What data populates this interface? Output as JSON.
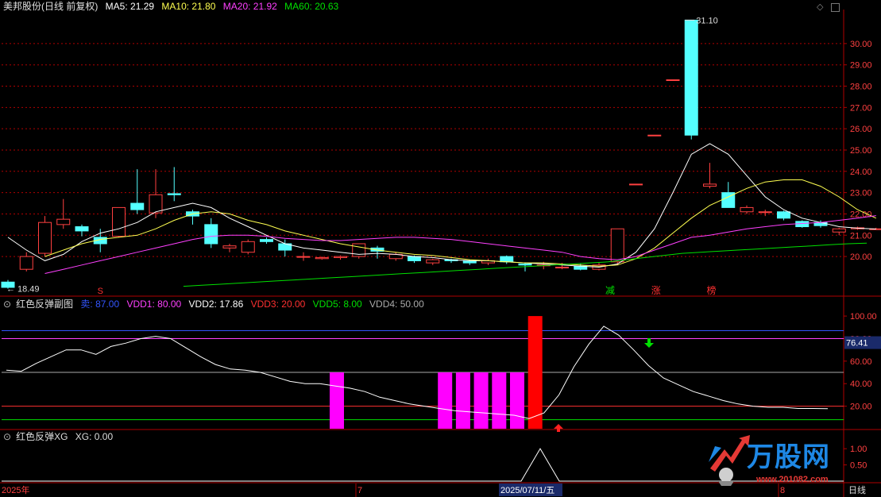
{
  "main_header": {
    "title": "美邦股份(日线 前复权)",
    "ma5": "MA5: 21.29",
    "ma10": "MA10: 21.80",
    "ma20": "MA20: 21.92",
    "ma60": "MA60: 20.63"
  },
  "sub_header": {
    "title": "红色反弹副图",
    "sell": "卖: 87.00",
    "vdd1": "VDD1: 80.00",
    "vdd2": "VDD2: 17.86",
    "vdd3": "VDD3: 20.00",
    "vdd5": "VDD5: 8.00",
    "vdd4": "VDD4: 50.00"
  },
  "sub2_header": {
    "title": "红色反弹XG",
    "xg": "XG: 0.00"
  },
  "labels": {
    "high": "31.10",
    "low": "18.49",
    "cur_value": "76.41",
    "mark_s": "S",
    "mark_jian": "减",
    "mark_zhang": "涨",
    "mark_bang": "榜"
  },
  "date_axis": {
    "start": "2025年",
    "m7": "7",
    "selected": "2025/07/11/五",
    "m8": "8",
    "period": "日线"
  },
  "watermark": {
    "text": "万股网",
    "url": "www.201082.com"
  },
  "colors": {
    "up": "#ff4040",
    "down": "#54ffff",
    "ma5": "#ffffff",
    "ma10": "#ffff50",
    "ma20": "#ff40ff",
    "ma60": "#00e000",
    "grid": "#b00000"
  },
  "chart_data": [
    {
      "type": "candlestick",
      "title": "美邦股份(日线 前复权)",
      "ylim": [
        18.4,
        31.3
      ],
      "y_ticks": [
        20.0,
        21.0,
        22.0,
        23.0,
        24.0,
        25.0,
        26.0,
        27.0,
        28.0,
        29.0,
        30.0
      ],
      "candles": [
        {
          "o": 18.8,
          "c": 18.55,
          "h": 18.9,
          "l": 18.49
        },
        {
          "o": 19.4,
          "c": 20.0,
          "h": 20.2,
          "l": 19.3
        },
        {
          "o": 20.15,
          "c": 21.6,
          "h": 21.9,
          "l": 20.0
        },
        {
          "o": 21.5,
          "c": 21.75,
          "h": 22.7,
          "l": 21.3
        },
        {
          "o": 21.4,
          "c": 21.2,
          "h": 21.5,
          "l": 20.95
        },
        {
          "o": 20.9,
          "c": 20.6,
          "h": 21.3,
          "l": 20.2
        },
        {
          "o": 20.95,
          "c": 22.3,
          "h": 22.3,
          "l": 20.9
        },
        {
          "o": 22.5,
          "c": 22.2,
          "h": 24.1,
          "l": 22.0
        },
        {
          "o": 22.05,
          "c": 22.9,
          "h": 24.1,
          "l": 21.8
        },
        {
          "o": 22.95,
          "c": 22.9,
          "h": 24.2,
          "l": 22.6
        },
        {
          "o": 22.1,
          "c": 21.9,
          "h": 22.2,
          "l": 21.5
        },
        {
          "o": 21.5,
          "c": 20.6,
          "h": 21.8,
          "l": 20.4
        },
        {
          "o": 20.4,
          "c": 20.5,
          "h": 20.6,
          "l": 20.2
        },
        {
          "o": 20.2,
          "c": 20.7,
          "h": 20.8,
          "l": 20.1
        },
        {
          "o": 20.8,
          "c": 20.7,
          "h": 20.9,
          "l": 20.6
        },
        {
          "o": 20.6,
          "c": 20.3,
          "h": 20.8,
          "l": 20.0
        },
        {
          "o": 20.0,
          "c": 20.0,
          "h": 20.2,
          "l": 19.8
        },
        {
          "o": 19.9,
          "c": 19.95,
          "h": 20.0,
          "l": 19.85
        },
        {
          "o": 19.95,
          "c": 20.0,
          "h": 20.05,
          "l": 19.85
        },
        {
          "o": 20.0,
          "c": 20.6,
          "h": 20.6,
          "l": 19.9
        },
        {
          "o": 20.4,
          "c": 20.25,
          "h": 20.5,
          "l": 19.9
        },
        {
          "o": 19.9,
          "c": 20.1,
          "h": 20.2,
          "l": 19.8
        },
        {
          "o": 20.0,
          "c": 19.8,
          "h": 20.05,
          "l": 19.7
        },
        {
          "o": 19.7,
          "c": 19.85,
          "h": 19.9,
          "l": 19.6
        },
        {
          "o": 19.85,
          "c": 19.8,
          "h": 19.9,
          "l": 19.7
        },
        {
          "o": 19.8,
          "c": 19.7,
          "h": 19.85,
          "l": 19.6
        },
        {
          "o": 19.7,
          "c": 19.8,
          "h": 19.9,
          "l": 19.6
        },
        {
          "o": 20.0,
          "c": 19.75,
          "h": 20.05,
          "l": 19.65
        },
        {
          "o": 19.65,
          "c": 19.6,
          "h": 19.7,
          "l": 19.3
        },
        {
          "o": 19.6,
          "c": 19.6,
          "h": 19.75,
          "l": 19.4
        },
        {
          "o": 19.5,
          "c": 19.5,
          "h": 19.7,
          "l": 19.4
        },
        {
          "o": 19.55,
          "c": 19.4,
          "h": 19.65,
          "l": 19.35
        },
        {
          "o": 19.4,
          "c": 19.6,
          "h": 19.7,
          "l": 19.35
        },
        {
          "o": 19.75,
          "c": 21.3,
          "h": 21.3,
          "l": 19.6
        },
        {
          "o": 23.4,
          "c": 23.4,
          "h": 23.4,
          "l": 23.4
        },
        {
          "o": 25.7,
          "c": 25.7,
          "h": 25.7,
          "l": 25.7
        },
        {
          "o": 28.3,
          "c": 28.3,
          "h": 28.3,
          "l": 28.3
        },
        {
          "o": 31.1,
          "c": 25.7,
          "h": 31.1,
          "l": 25.5
        },
        {
          "o": 23.3,
          "c": 23.4,
          "h": 24.4,
          "l": 23.2
        },
        {
          "o": 23.0,
          "c": 22.3,
          "h": 23.5,
          "l": 22.3
        },
        {
          "o": 22.1,
          "c": 22.3,
          "h": 22.4,
          "l": 22.0
        },
        {
          "o": 22.1,
          "c": 22.1,
          "h": 22.2,
          "l": 21.9
        },
        {
          "o": 22.1,
          "c": 21.8,
          "h": 22.15,
          "l": 21.7
        },
        {
          "o": 21.65,
          "c": 21.4,
          "h": 21.7,
          "l": 21.35
        },
        {
          "o": 21.6,
          "c": 21.45,
          "h": 21.7,
          "l": 21.35
        },
        {
          "o": 21.15,
          "c": 21.3,
          "h": 21.35,
          "l": 21.0
        },
        {
          "o": 21.3,
          "c": 21.35,
          "h": 21.4,
          "l": 21.25
        },
        {
          "o": 21.3,
          "c": 21.3,
          "h": 21.35,
          "l": 21.25
        }
      ],
      "series": [
        {
          "name": "MA5",
          "values": [
            20.9,
            20.3,
            19.8,
            20.1,
            20.7,
            21.1,
            21.3,
            21.6,
            22.1,
            22.3,
            22.5,
            22.3,
            21.8,
            21.4,
            21.0,
            20.6,
            20.4,
            20.3,
            20.2,
            20.1,
            20.15,
            20.1,
            20.0,
            19.95,
            19.85,
            19.8,
            19.8,
            19.75,
            19.7,
            19.65,
            19.6,
            19.55,
            19.5,
            19.65,
            20.2,
            21.3,
            23.0,
            24.8,
            25.3,
            24.8,
            23.8,
            22.8,
            22.2,
            21.8,
            21.6,
            21.4,
            21.33,
            21.29
          ]
        },
        {
          "name": "MA10",
          "values": [
            null,
            null,
            20.0,
            20.3,
            20.6,
            20.8,
            20.9,
            21.0,
            21.3,
            21.7,
            22.0,
            22.1,
            22.0,
            21.7,
            21.5,
            21.2,
            21.0,
            20.8,
            20.6,
            20.45,
            20.3,
            20.2,
            20.1,
            20.05,
            19.95,
            19.85,
            19.8,
            19.75,
            19.7,
            19.7,
            19.65,
            19.6,
            19.55,
            19.6,
            19.9,
            20.4,
            21.1,
            21.8,
            22.4,
            22.8,
            23.2,
            23.5,
            23.6,
            23.6,
            23.3,
            22.8,
            22.2,
            21.8
          ]
        },
        {
          "name": "MA20",
          "values": [
            null,
            null,
            19.2,
            19.4,
            19.6,
            19.8,
            20.0,
            20.2,
            20.4,
            20.6,
            20.8,
            20.95,
            21.0,
            21.0,
            20.95,
            20.85,
            20.8,
            20.75,
            20.75,
            20.8,
            20.85,
            20.9,
            20.9,
            20.85,
            20.8,
            20.7,
            20.6,
            20.5,
            20.4,
            20.3,
            20.2,
            20.0,
            19.9,
            19.85,
            20.0,
            20.3,
            20.6,
            20.9,
            21.0,
            21.15,
            21.3,
            21.4,
            21.5,
            21.55,
            21.6,
            21.7,
            21.8,
            21.92
          ]
        },
        {
          "name": "MA60",
          "values": [
            null,
            null,
            null,
            null,
            null,
            null,
            null,
            null,
            18.6,
            18.65,
            18.7,
            18.75,
            18.8,
            18.85,
            18.9,
            18.95,
            19.0,
            19.05,
            19.1,
            19.15,
            19.2,
            19.25,
            19.3,
            19.35,
            19.4,
            19.45,
            19.5,
            19.55,
            19.6,
            19.65,
            19.7,
            19.75,
            19.85,
            19.95,
            20.05,
            20.15,
            20.2,
            20.25,
            20.3,
            20.35,
            20.4,
            20.45,
            20.5,
            20.55,
            20.6,
            20.63
          ]
        }
      ]
    },
    {
      "type": "line",
      "title": "红色反弹副图",
      "ylim": [
        0,
        105
      ],
      "y_ticks": [
        20.0,
        40.0,
        60.0,
        80.0,
        100.0
      ],
      "levels": {
        "sell": 87.0,
        "vdd1": 80.0,
        "vdd4": 50.0,
        "vdd3": 20.0,
        "vdd5": 8.0
      },
      "series": [
        {
          "name": "VDD2",
          "values": [
            52,
            51,
            58,
            64,
            70,
            70,
            66,
            73,
            76,
            80,
            82,
            80,
            72,
            64,
            57,
            53,
            52,
            50,
            46,
            42,
            40,
            40,
            38,
            36,
            33,
            28,
            25,
            22,
            20,
            18,
            16,
            15,
            14,
            13,
            12,
            9,
            14,
            30,
            55,
            75,
            91,
            83,
            70,
            56,
            45,
            39,
            33,
            29,
            25,
            22,
            20,
            19,
            19,
            18,
            18,
            17.86
          ]
        }
      ],
      "bars": [
        {
          "index": 18,
          "value": 50,
          "color": "#ff00ff"
        },
        {
          "index": 24,
          "value": 50,
          "color": "#ff00ff"
        },
        {
          "index": 25,
          "value": 50,
          "color": "#ff00ff"
        },
        {
          "index": 26,
          "value": 50,
          "color": "#ff00ff"
        },
        {
          "index": 27,
          "value": 50,
          "color": "#ff00ff"
        },
        {
          "index": 28,
          "value": 50,
          "color": "#ff00ff"
        },
        {
          "index": 29,
          "value": 100,
          "color": "#ff0000"
        }
      ]
    },
    {
      "type": "line",
      "title": "红色反弹XG",
      "ylim": [
        0,
        1.2
      ],
      "y_ticks": [
        0.5,
        1.0
      ],
      "series": [
        {
          "name": "XG",
          "values": [
            0,
            1,
            0
          ]
        }
      ]
    }
  ]
}
